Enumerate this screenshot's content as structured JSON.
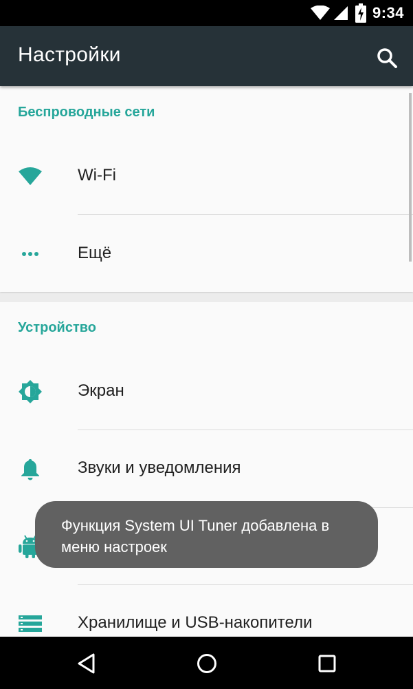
{
  "status_bar": {
    "time": "9:34"
  },
  "app_bar": {
    "title": "Настройки",
    "search_icon": "search-icon"
  },
  "sections": [
    {
      "header": "Беспроводные сети",
      "items": [
        {
          "label": "Wi-Fi",
          "icon": "wifi-icon"
        },
        {
          "label": "Ещё",
          "icon": "more-dots-icon"
        }
      ]
    },
    {
      "header": "Устройство",
      "items": [
        {
          "label": "Экран",
          "icon": "brightness-icon"
        },
        {
          "label": "Звуки и уведомления",
          "icon": "bell-icon"
        },
        {
          "label": "",
          "icon": "android-icon"
        },
        {
          "label": "Хранилище и USB-накопители",
          "icon": "storage-icon"
        }
      ]
    }
  ],
  "toast": {
    "message": "Функция System UI Tuner добавлена в меню настроек"
  },
  "nav_bar": {
    "back_icon": "back-icon",
    "home_icon": "home-icon",
    "recents_icon": "recents-icon"
  },
  "colors": {
    "accent": "#26a69a",
    "app_bar": "#263238",
    "toast": "#616161"
  }
}
